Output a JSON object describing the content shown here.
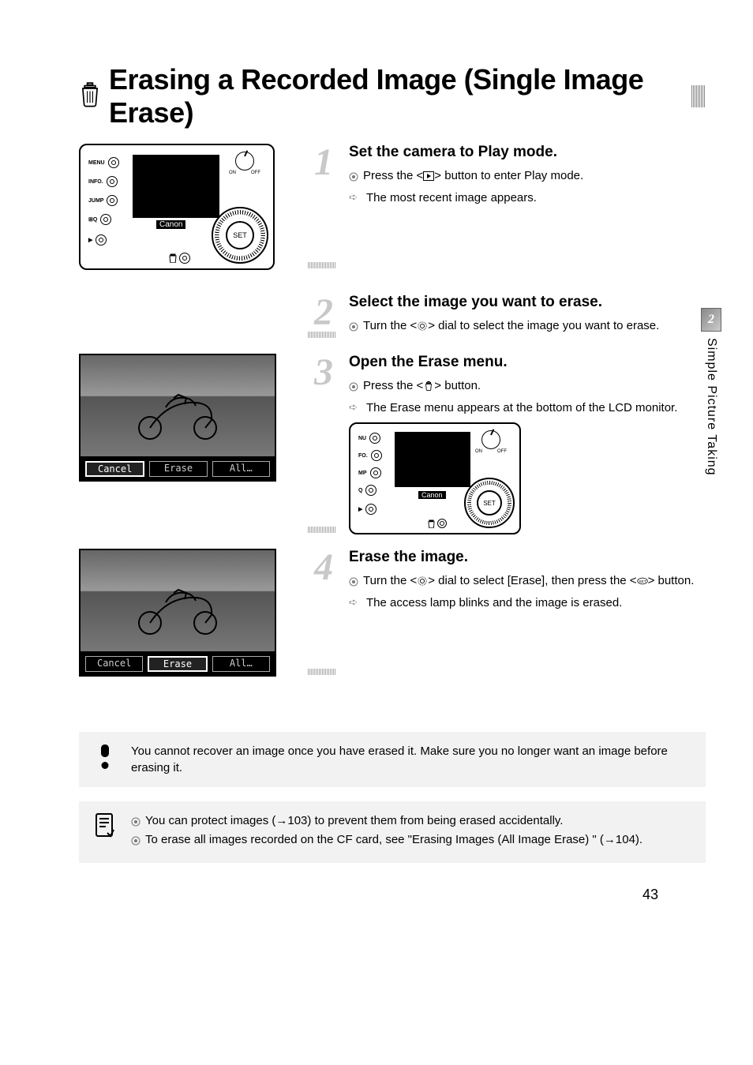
{
  "title": "Erasing a Recorded Image (Single Image Erase)",
  "side_tab": {
    "num": "2",
    "label": "Simple Picture Taking"
  },
  "camera": {
    "logo": "Canon",
    "set": "SET",
    "on": "ON",
    "off": "OFF",
    "btn_menu": "MENU",
    "btn_info": "INFO.",
    "btn_jump": "JUMP"
  },
  "lcd_buttons": {
    "cancel": "Cancel",
    "erase": "Erase",
    "all": "All…"
  },
  "steps": [
    {
      "num": "1",
      "head": "Set the camera to Play mode.",
      "lines": [
        {
          "type": "gear",
          "pre": "Press the <",
          "icon": "play",
          "post": "> button to enter Play mode."
        },
        {
          "type": "arrow",
          "text": "The most recent image appears."
        }
      ]
    },
    {
      "num": "2",
      "head": "Select the image you want to erase.",
      "lines": [
        {
          "type": "gear",
          "pre": "Turn the <",
          "icon": "dial",
          "post": "> dial to select the image you want to erase."
        }
      ]
    },
    {
      "num": "3",
      "head": "Open the Erase menu.",
      "lines": [
        {
          "type": "gear",
          "pre": "Press the <",
          "icon": "trash",
          "post": "> button."
        },
        {
          "type": "arrow",
          "text": "The Erase menu appears at the bottom of the LCD monitor."
        }
      ]
    },
    {
      "num": "4",
      "head": "Erase the image.",
      "lines": [
        {
          "type": "gear",
          "pre": "Turn the <",
          "icon": "dial",
          "post": "> dial to select [Erase], then press the <",
          "icon2": "set",
          "post2": "> button."
        },
        {
          "type": "arrow",
          "text": "The access lamp blinks and the image is erased."
        }
      ]
    }
  ],
  "notes": {
    "warn": "You cannot recover an image once you have erased it. Make sure you no longer want an image before erasing it.",
    "info1": "You can protect images (→103) to prevent them from being erased accidentally.",
    "info2": "To erase all images recorded on the CF card, see \"Erasing Images (All Image Erase) \" (→104)."
  },
  "page_number": "43"
}
